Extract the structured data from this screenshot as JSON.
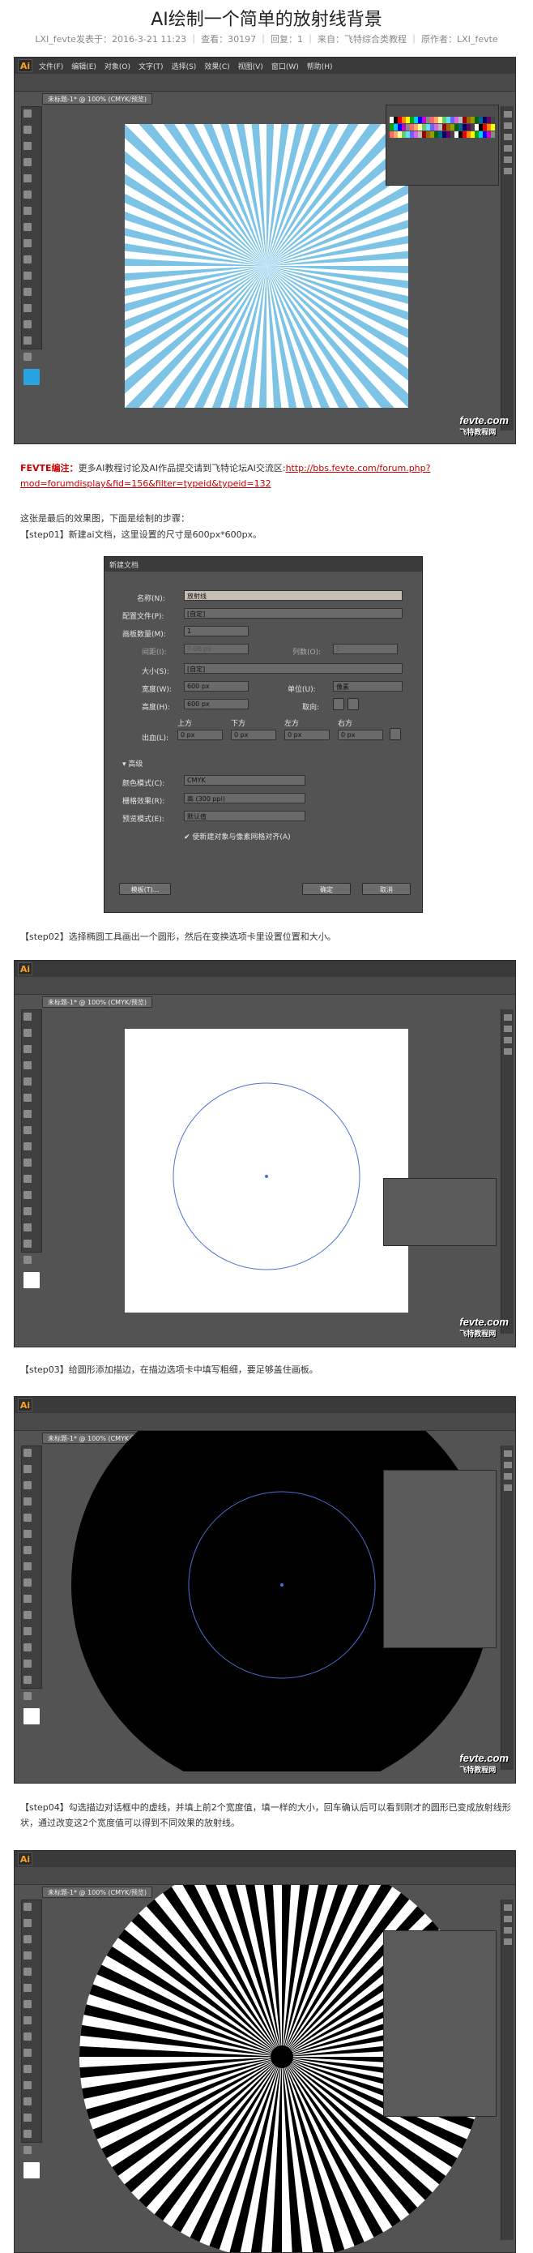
{
  "article": {
    "title": "AI绘制一个简单的放射线背景",
    "meta": "LXI_fevte发表于：2016-3-21 11:23 ｜ 查看：30197 ｜ 回复：1 ｜ 来自：飞特综合类教程 ｜ 原作者：LXI_fevte",
    "note_label": "FEVTE编注：",
    "note_text": "更多AI教程讨论及AI作品提交请到飞特论坛AI交流区:",
    "note_link": "http://bbs.fevte.com/forum.php?mod=forumdisplay&fid=156&filter=typeid&typeid=132",
    "intro": "这张是最后的效果图，下面是绘制的步骤：",
    "step01": "【step01】新建ai文档，这里设置的尺寸是600px*600px。",
    "step02": "【step02】选择椭圆工具画出一个圆形，然后在变换选项卡里设置位置和大小。",
    "step03": "【step03】给圆形添加描边，在描边选项卡中填写粗细，要足够盖住画板。",
    "step04": "【step04】勾选描边对话框中的虚线，并填上前2个宽度值，填一样的大小，回车确认后可以看到刚才的圆形已变成放射线形状，通过改变这2个宽度值可以得到不同效果的放射线。"
  },
  "ai_window": {
    "logo": "Ai",
    "menus": [
      "文件(F)",
      "编辑(E)",
      "对象(O)",
      "文字(T)",
      "选择(S)",
      "效果(C)",
      "视图(V)",
      "窗口(W)",
      "帮助(H)"
    ],
    "doc_tab": "未标题-1* @ 100% (CMYK/预览)",
    "watermark": "fevte.com",
    "watermark_cn": "飞特教程网"
  },
  "dialog": {
    "title": "新建文档",
    "name_label": "名称(N):",
    "name_value": "放射线",
    "profile_label": "配置文件(P):",
    "profile_value": "[自定]",
    "artboards_label": "画板数量(M):",
    "artboards_value": "1",
    "spacing_label": "间距(I):",
    "spacing_value": "7.06 px",
    "columns_label": "列数(O):",
    "columns_value": "1",
    "size_label": "大小(S):",
    "size_value": "[自定]",
    "width_label": "宽度(W):",
    "width_value": "600 px",
    "units_label": "单位(U):",
    "units_value": "像素",
    "height_label": "高度(H):",
    "height_value": "600 px",
    "orientation_label": "取向:",
    "bleed_label": "出血(L):",
    "bleed_top": "上方",
    "bleed_bottom": "下方",
    "bleed_left": "左方",
    "bleed_right": "右方",
    "bleed_value": "0 px",
    "advanced": "高级",
    "color_mode_label": "颜色模式(C):",
    "color_mode_value": "CMYK",
    "raster_label": "栅格效果(R):",
    "raster_value": "高 (300 ppi)",
    "preview_label": "预览模式(E):",
    "preview_value": "默认值",
    "align_check": "使新建对象与像素网格对齐(A)",
    "template_button": "模板(T)...",
    "ok_button": "确定",
    "cancel_button": "取消"
  },
  "colors": {
    "ray_blue": "#7cc3e6",
    "ui_dark": "#535353",
    "accent_red": "#cc0000"
  }
}
